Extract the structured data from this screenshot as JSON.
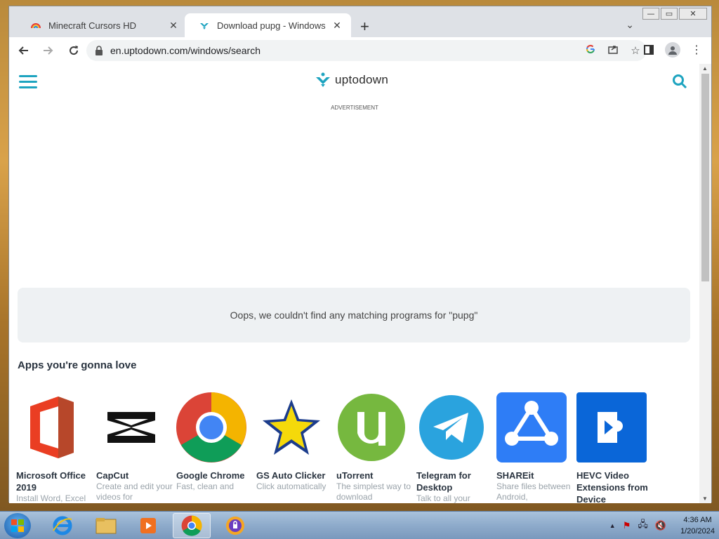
{
  "browser": {
    "tabs": [
      {
        "title": "Minecraft Cursors HD",
        "active": false
      },
      {
        "title": "Download pupg - Windows",
        "active": true
      }
    ],
    "url": "en.uptodown.com/windows/search",
    "window_controls": {
      "minimize": "—",
      "restore": "▭",
      "close": "✕"
    }
  },
  "site": {
    "logo_text": "uptodown",
    "advertisement_label": "ADVERTISEMENT",
    "not_found_message": "Oops, we couldn't find any matching programs for \"pupg\"",
    "section_title": "Apps you're gonna love",
    "apps": [
      {
        "name": "Microsoft Office 2019",
        "desc": "Install Word, Excel",
        "icon": "office-icon"
      },
      {
        "name": "CapCut",
        "desc": "Create and edit your videos for",
        "icon": "capcut-icon"
      },
      {
        "name": "Google Chrome",
        "desc": "Fast, clean and",
        "icon": "chrome-icon"
      },
      {
        "name": "GS Auto Clicker",
        "desc": "Click automatically",
        "icon": "star-icon"
      },
      {
        "name": "uTorrent",
        "desc": "The simplest way to download",
        "icon": "utorrent-icon"
      },
      {
        "name": "Telegram for Desktop",
        "desc": "Talk to all your",
        "icon": "telegram-icon"
      },
      {
        "name": "SHAREit",
        "desc": "Share files between Android,",
        "icon": "shareit-icon"
      },
      {
        "name": "HEVC Video Extensions from Device",
        "desc": "",
        "icon": "hevc-icon"
      }
    ]
  },
  "taskbar": {
    "time": "4:36 AM",
    "date": "1/20/2024"
  },
  "colors": {
    "brand": "#1ea4c0",
    "chrome_frame": "#dee1e6"
  }
}
